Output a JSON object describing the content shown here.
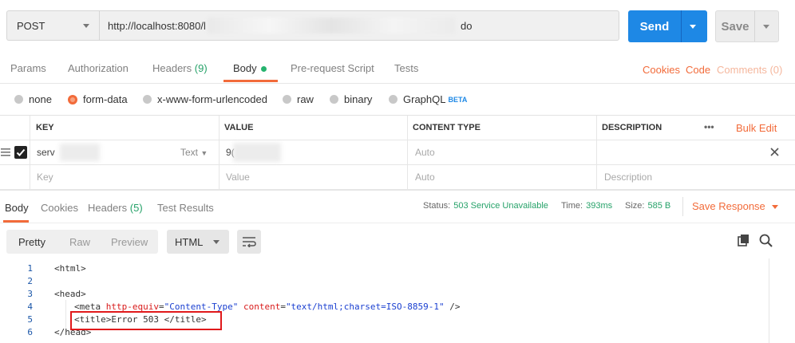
{
  "request": {
    "method": "POST",
    "url_prefix": "http://localhost:8080/l",
    "url_suffix": "do",
    "send_label": "Send",
    "save_label": "Save"
  },
  "request_tabs": {
    "params": "Params",
    "authorization": "Authorization",
    "headers": "Headers",
    "headers_count": "(9)",
    "body": "Body",
    "pre_request": "Pre-request Script",
    "tests": "Tests",
    "cookies": "Cookies",
    "code": "Code",
    "comments": "Comments (0)"
  },
  "body_types": {
    "none": "none",
    "form_data": "form-data",
    "urlencoded": "x-www-form-urlencoded",
    "raw": "raw",
    "binary": "binary",
    "graphql": "GraphQL",
    "graphql_badge": "BETA",
    "selected": "form-data"
  },
  "params_table": {
    "headers": {
      "key": "KEY",
      "value": "VALUE",
      "content_type": "CONTENT TYPE",
      "description": "DESCRIPTION",
      "more": "•••",
      "bulk_edit": "Bulk Edit"
    },
    "row": {
      "key": "serv",
      "type": "Text",
      "value": "9(",
      "content_type": "Auto",
      "checked": true
    },
    "placeholder": {
      "key": "Key",
      "value": "Value",
      "content_type": "Auto",
      "description": "Description"
    }
  },
  "response": {
    "tabs": {
      "body": "Body",
      "cookies": "Cookies",
      "headers": "Headers",
      "headers_count": "(5)",
      "test_results": "Test Results"
    },
    "status_label": "Status:",
    "status_value": "503 Service Unavailable",
    "time_label": "Time:",
    "time_value": "393ms",
    "size_label": "Size:",
    "size_value": "585 B",
    "save_response": "Save Response",
    "view": {
      "pretty": "Pretty",
      "raw": "Raw",
      "preview": "Preview",
      "format": "HTML"
    }
  },
  "code_lines": [
    {
      "n": "1",
      "text": "<html>"
    },
    {
      "n": "2",
      "text": ""
    },
    {
      "n": "3",
      "text": "<head>"
    },
    {
      "n": "4",
      "tag_open": "<meta ",
      "attr1": "http-equiv",
      "eq1": "=",
      "val1": "\"Content-Type\"",
      "sp": " ",
      "attr2": "content",
      "eq2": "=",
      "val2": "\"text/html;charset=ISO-8859-1\"",
      "tag_close": " />"
    },
    {
      "n": "5",
      "text": "<title>Error 503 </title>"
    },
    {
      "n": "6",
      "text": "</head>"
    }
  ],
  "colors": {
    "accent": "#f26b3a",
    "send": "#1e88e5",
    "success_green": "#26a269",
    "highlight_box": "#e0191b"
  }
}
